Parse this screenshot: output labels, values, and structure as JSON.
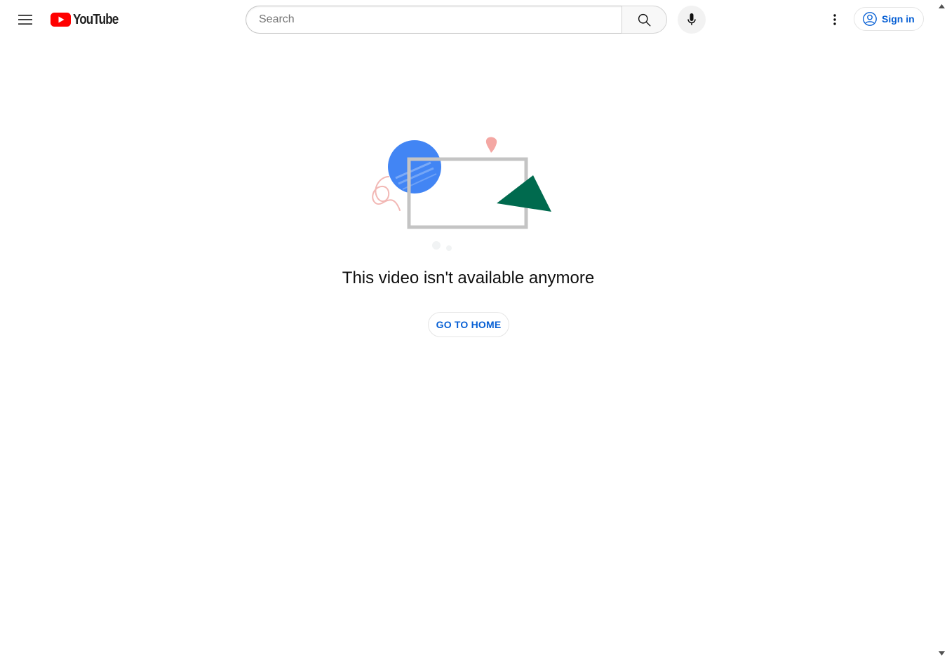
{
  "masthead": {
    "menu_icon": "hamburger-menu-icon",
    "logo_text": "YouTube",
    "logo_color": "#ff0000",
    "search": {
      "placeholder": "Search",
      "value": ""
    },
    "search_icon": "search-icon",
    "mic_icon": "microphone-icon",
    "more_icon": "vertical-dots-icon",
    "signin_label": "Sign in",
    "signin_icon": "user-circle-icon",
    "accent_color": "#065fd4"
  },
  "error": {
    "illustration": "unavailable-video-illustration",
    "message": "This video isn't available anymore",
    "home_button_label": "GO TO HOME"
  }
}
